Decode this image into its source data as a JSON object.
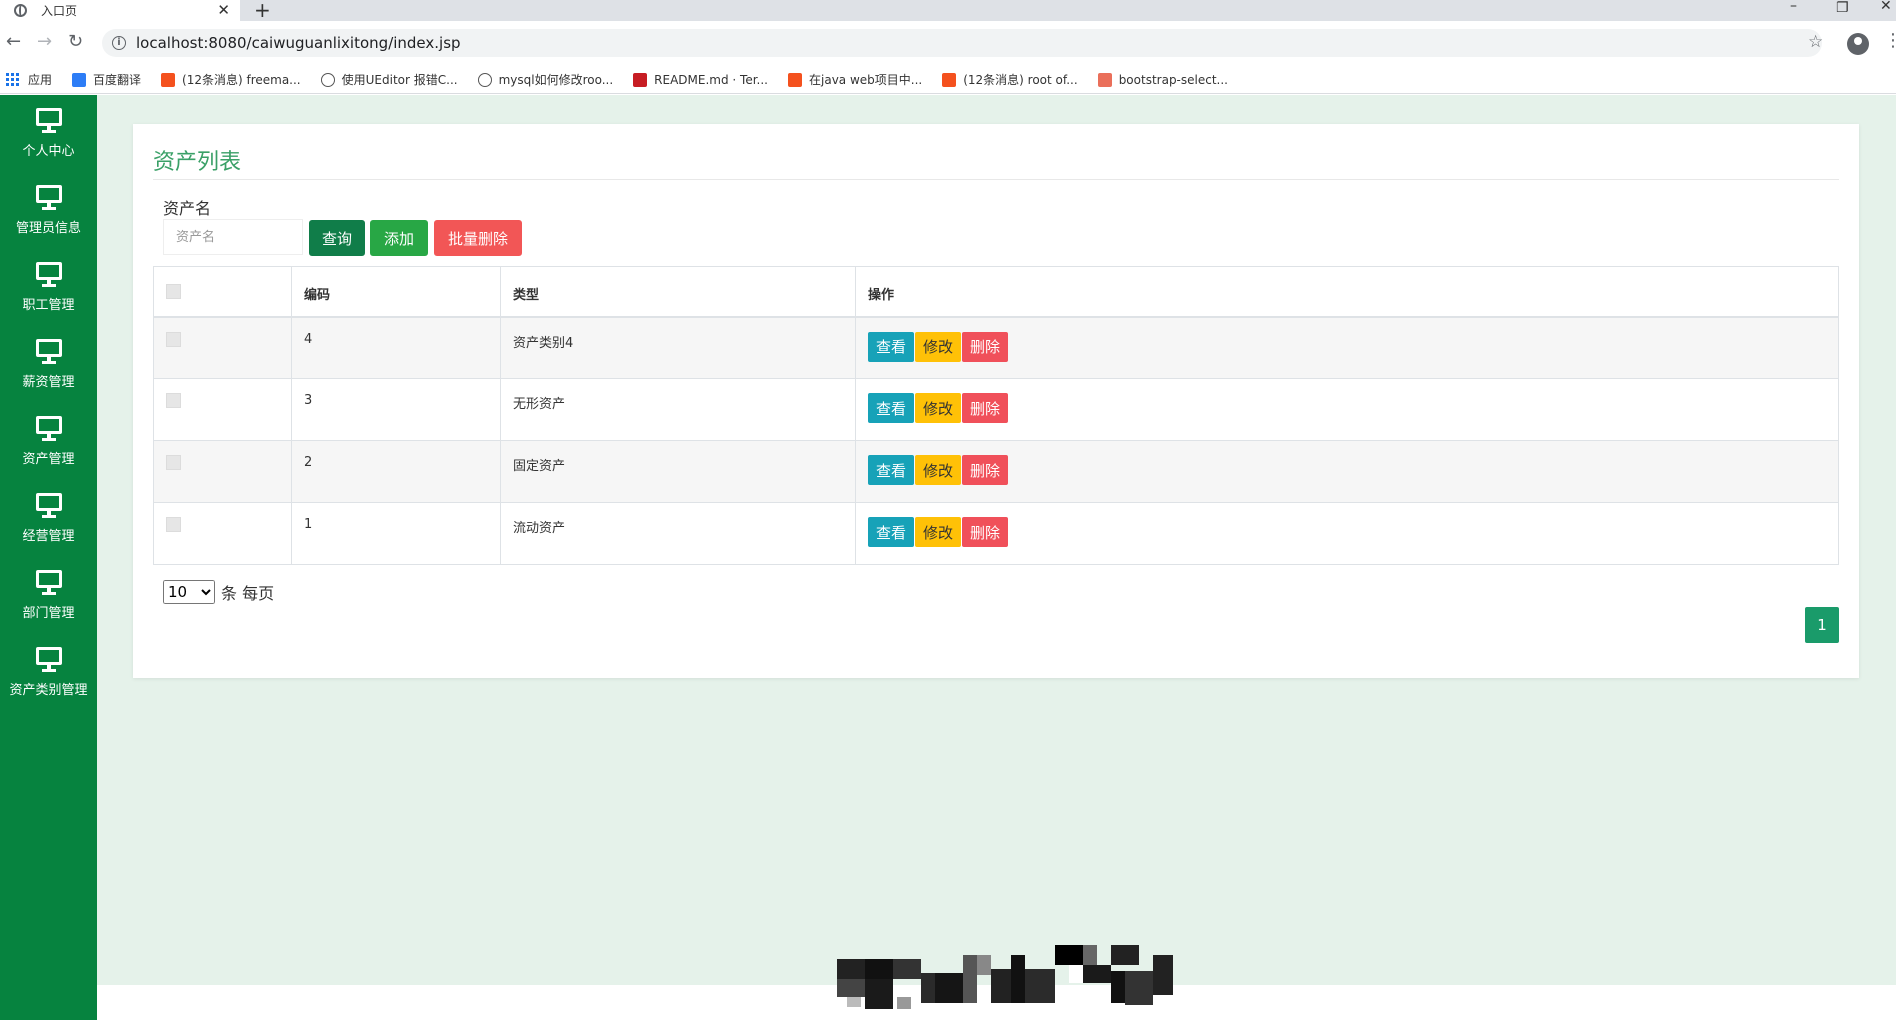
{
  "browser": {
    "tab_title": "入口页",
    "url": "localhost:8080/caiwuguanlixitong/index.jsp",
    "bookmarks": [
      {
        "label": "应用",
        "icon": "apps-grid-icon"
      },
      {
        "label": "百度翻译",
        "icon": "baidu-translate-icon",
        "color": "#2d7df6"
      },
      {
        "label": "(12条消息) freema...",
        "icon": "csdn-icon",
        "color": "#f4511e"
      },
      {
        "label": "使用UEditor 报错C...",
        "icon": "link-icon"
      },
      {
        "label": "mysql如何修改roo...",
        "icon": "link-icon"
      },
      {
        "label": "README.md · Ter...",
        "icon": "gitee-icon",
        "color": "#c71d23"
      },
      {
        "label": "在java web项目中...",
        "icon": "csdn-icon",
        "color": "#f4511e"
      },
      {
        "label": "(12条消息) root of...",
        "icon": "csdn-icon",
        "color": "#f4511e"
      },
      {
        "label": "bootstrap-select...",
        "icon": "jianshu-icon",
        "color": "#ea6f5a"
      }
    ]
  },
  "sidebar": {
    "items": [
      {
        "label": "个人中心",
        "icon": "monitor-icon"
      },
      {
        "label": "管理员信息",
        "icon": "monitor-icon"
      },
      {
        "label": "职工管理",
        "icon": "monitor-icon"
      },
      {
        "label": "薪资管理",
        "icon": "monitor-icon"
      },
      {
        "label": "资产管理",
        "icon": "monitor-icon"
      },
      {
        "label": "经营管理",
        "icon": "monitor-icon"
      },
      {
        "label": "部门管理",
        "icon": "monitor-icon"
      },
      {
        "label": "资产类别管理",
        "icon": "monitor-icon"
      }
    ]
  },
  "page": {
    "title": "资产列表",
    "search": {
      "label": "资产名",
      "placeholder": "资产名",
      "value": ""
    },
    "buttons": {
      "query": "查询",
      "add": "添加",
      "batch_delete": "批量删除"
    },
    "table": {
      "headers": [
        "",
        "编码",
        "类型",
        "操作"
      ],
      "rows": [
        {
          "code": "4",
          "type": "资产类别4"
        },
        {
          "code": "3",
          "type": "无形资产"
        },
        {
          "code": "2",
          "type": "固定资产"
        },
        {
          "code": "1",
          "type": "流动资产"
        }
      ],
      "actions": {
        "view": "查看",
        "edit": "修改",
        "delete": "删除"
      }
    },
    "pagination": {
      "page_size": "10",
      "page_size_suffix": "条 每页",
      "current_page": "1"
    }
  },
  "colors": {
    "sidebar_bg": "#06833f",
    "title_green": "#3aa067",
    "query_btn": "#107d49",
    "add_btn": "#28a745",
    "batch_delete_btn": "#f25656",
    "view_btn": "#17a2b8",
    "edit_btn": "#ffc107",
    "delete_btn": "#f0505a"
  }
}
